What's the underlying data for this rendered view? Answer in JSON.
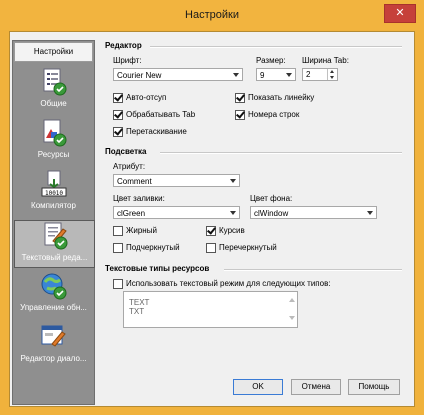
{
  "window": {
    "title": "Настройки",
    "close_glyph": "✕"
  },
  "sidebar": {
    "header": "Настройки",
    "items": [
      {
        "label": "Общие",
        "icon": "general-settings-icon"
      },
      {
        "label": "Ресурсы",
        "icon": "resources-icon"
      },
      {
        "label": "Компилятор",
        "icon": "compiler-icon"
      },
      {
        "label": "Текстовый реда...",
        "icon": "text-editor-icon",
        "selected": true
      },
      {
        "label": "Управление обн...",
        "icon": "update-management-icon"
      },
      {
        "label": "Редактор диало...",
        "icon": "dialog-editor-icon"
      }
    ]
  },
  "editor": {
    "section": "Редактор",
    "font_label": "Шрифт:",
    "font_value": "Courier New",
    "size_label": "Размер:",
    "size_value": "9",
    "tab_label": "Ширина Tab:",
    "tab_value": "2",
    "checkboxes": [
      {
        "label": "Авто-отсуп",
        "checked": true
      },
      {
        "label": "Показать линейку",
        "checked": true
      },
      {
        "label": "Обрабатывать Tab",
        "checked": true
      },
      {
        "label": "Номера строк",
        "checked": true
      },
      {
        "label": "Перетаскивание",
        "checked": true
      }
    ]
  },
  "highlight": {
    "section": "Подсветка",
    "attribute_label": "Атрибут:",
    "attribute_value": "Comment",
    "fill_label": "Цвет заливки:",
    "fill_value": "clGreen",
    "bg_label": "Цвет фона:",
    "bg_value": "clWindow",
    "checkboxes": [
      {
        "label": "Жирный",
        "checked": false
      },
      {
        "label": "Курсив",
        "checked": true
      },
      {
        "label": "Подчеркнутый",
        "checked": false
      },
      {
        "label": "Перечеркнутый",
        "checked": false
      }
    ]
  },
  "resource_types": {
    "section": "Текстовые типы ресурсов",
    "checkbox_label": "Использовать текстовый режим для следующих типов:",
    "checked": false,
    "items": [
      "TEXT",
      "TXT"
    ]
  },
  "buttons": {
    "ok": "OK",
    "cancel": "Отмена",
    "help": "Помощь"
  }
}
